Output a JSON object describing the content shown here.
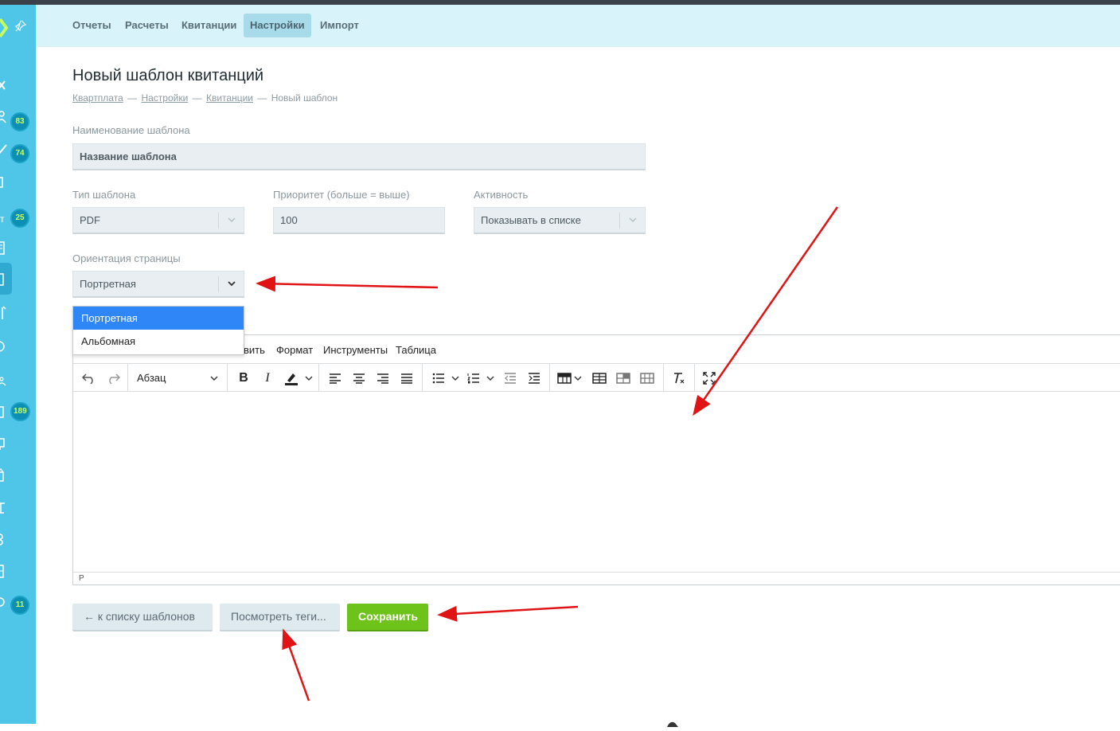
{
  "sidebar": {
    "badges": [
      "83",
      "74",
      "25",
      "189",
      "11"
    ],
    "label_t": "т"
  },
  "nav": {
    "tabs": [
      {
        "label": "Отчеты"
      },
      {
        "label": "Расчеты"
      },
      {
        "label": "Квитанции"
      },
      {
        "label": "Настройки",
        "active": true
      },
      {
        "label": "Импорт"
      }
    ]
  },
  "page": {
    "title": "Новый шаблон квитанций",
    "breadcrumb": [
      "Квартплата",
      "Настройки",
      "Квитанции",
      "Новый шаблон"
    ],
    "breadcrumb_sep": "—"
  },
  "form": {
    "name_label": "Наименование шаблона",
    "name_value": "Название шаблона",
    "type_label": "Тип шаблона",
    "type_value": "PDF",
    "priority_label": "Приоритет (больше = выше)",
    "priority_value": "100",
    "activity_label": "Активность",
    "activity_value": "Показывать в списке",
    "orientation_label": "Ориентация страницы",
    "orientation_value": "Портретная",
    "orientation_options": [
      "Портретная",
      "Альбомная"
    ]
  },
  "editor": {
    "menu_partial": "вить",
    "menu": [
      "Формат",
      "Инструменты",
      "Таблица"
    ],
    "block_format": "Абзац",
    "status_path": "P"
  },
  "buttons": {
    "back": "← к списку шаблонов",
    "view_tags": "Посмотреть теги...",
    "save": "Сохранить"
  },
  "colors": {
    "sidebar": "#4fc6e8",
    "nav_bg": "#d9f3fa",
    "save_green": "#6ec31b",
    "dropdown_selected": "#2f86f6",
    "annotation_red": "#e01414",
    "badge_text": "#c6ff5a"
  }
}
